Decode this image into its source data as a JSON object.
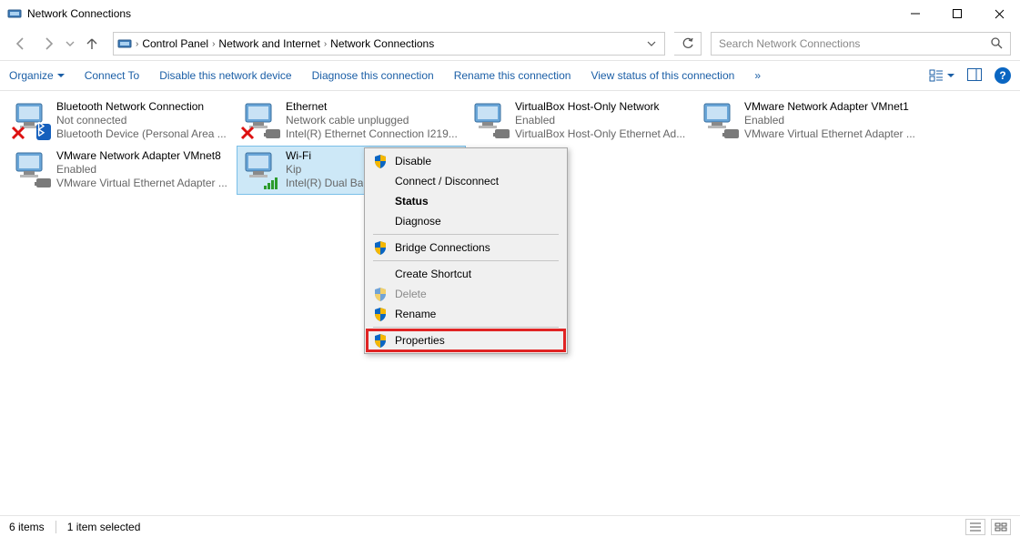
{
  "window": {
    "title": "Network Connections"
  },
  "breadcrumb": {
    "segments": [
      "Control Panel",
      "Network and Internet",
      "Network Connections"
    ]
  },
  "search": {
    "placeholder": "Search Network Connections"
  },
  "toolbar": {
    "organize": "Organize",
    "connect_to": "Connect To",
    "disable": "Disable this network device",
    "diagnose": "Diagnose this connection",
    "rename": "Rename this connection",
    "view_status": "View status of this connection",
    "more": "»"
  },
  "items": [
    {
      "name": "Bluetooth Network Connection",
      "status": "Not connected",
      "device": "Bluetooth Device (Personal Area ...",
      "error": true,
      "kind": "bluetooth"
    },
    {
      "name": "Ethernet",
      "status": "Network cable unplugged",
      "device": "Intel(R) Ethernet Connection I219...",
      "error": true,
      "kind": "ethernet"
    },
    {
      "name": "VirtualBox Host-Only Network",
      "status": "Enabled",
      "device": "VirtualBox Host-Only Ethernet Ad...",
      "error": false,
      "kind": "ethernet"
    },
    {
      "name": "VMware Network Adapter VMnet1",
      "status": "Enabled",
      "device": "VMware Virtual Ethernet Adapter ...",
      "error": false,
      "kind": "ethernet"
    },
    {
      "name": "VMware Network Adapter VMnet8",
      "status": "Enabled",
      "device": "VMware Virtual Ethernet Adapter ...",
      "error": false,
      "kind": "ethernet"
    },
    {
      "name": "Wi-Fi",
      "status": "Kip",
      "device": "Intel(R) Dual Ba",
      "error": false,
      "kind": "wifi",
      "selected": true
    }
  ],
  "context_menu": {
    "disable": "Disable",
    "connect_disconnect": "Connect / Disconnect",
    "status": "Status",
    "diagnose": "Diagnose",
    "bridge": "Bridge Connections",
    "create_shortcut": "Create Shortcut",
    "delete": "Delete",
    "rename": "Rename",
    "properties": "Properties"
  },
  "statusbar": {
    "count": "6 items",
    "selection": "1 item selected"
  }
}
